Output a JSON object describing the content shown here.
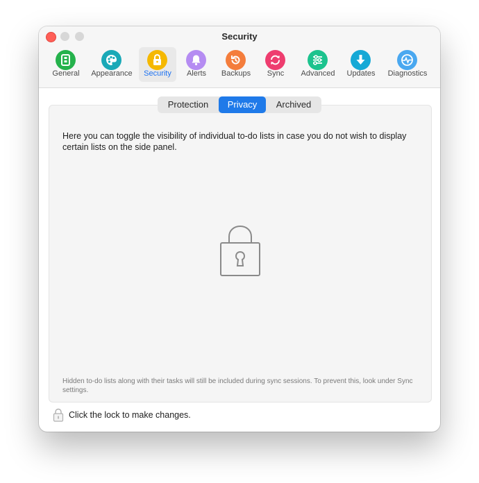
{
  "window": {
    "title": "Security"
  },
  "toolbar": {
    "items": [
      {
        "label": "General",
        "icon": "general-icon",
        "color": "#25b24c"
      },
      {
        "label": "Appearance",
        "icon": "palette-icon",
        "color": "#1aa9b7"
      },
      {
        "label": "Security",
        "icon": "lock-icon",
        "color": "#f5b800"
      },
      {
        "label": "Alerts",
        "icon": "bell-icon",
        "color": "#b58cf2"
      },
      {
        "label": "Backups",
        "icon": "backup-icon",
        "color": "#f47d3c"
      },
      {
        "label": "Sync",
        "icon": "sync-icon",
        "color": "#ee3d6f"
      },
      {
        "label": "Advanced",
        "icon": "sliders-icon",
        "color": "#1cc38e"
      },
      {
        "label": "Updates",
        "icon": "download-icon",
        "color": "#16a9d6"
      },
      {
        "label": "Diagnostics",
        "icon": "diagnostics-icon",
        "color": "#4aa8f0"
      }
    ],
    "selected": "Security"
  },
  "tabs": {
    "items": [
      "Protection",
      "Privacy",
      "Archived"
    ],
    "selected": "Privacy"
  },
  "content": {
    "description": "Here you can toggle the visibility of individual to-do lists in case you do not wish to display certain lists on the side panel.",
    "footnote": "Hidden to-do lists along with their tasks will still be included during sync sessions. To prevent this, look under Sync settings."
  },
  "footer": {
    "lock_text": "Click the lock to make changes."
  },
  "colors": {
    "accent": "#1f7ae9",
    "close_button": "#ff5f57"
  }
}
